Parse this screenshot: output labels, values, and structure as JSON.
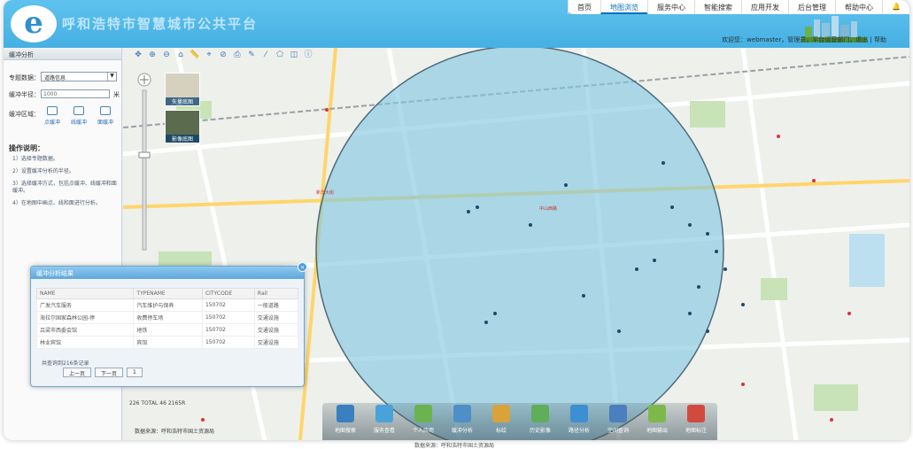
{
  "header": {
    "logo_letter": "e",
    "system_title": "呼和浩特市智慧城市公共平台",
    "nav": [
      "首页",
      "地图浏览",
      "服务中心",
      "智能搜索",
      "应用开发",
      "后台管理",
      "帮助中心"
    ],
    "nav_active_index": 1,
    "user_info": "欢迎您：webmaster，管理员，平台运营部门，退出 | 帮助"
  },
  "sidebar": {
    "panel_title": "缓冲分析",
    "topic_label": "专题数据：",
    "topic_value": "道路信息",
    "radius_label": "缓冲半径：",
    "radius_value": "1000",
    "radius_unit": "米",
    "area_label": "缓冲区域：",
    "tools": [
      "点缓冲",
      "线缓冲",
      "面缓冲"
    ],
    "instructions_title": "操作说明：",
    "instructions": [
      "1）选择专题数据。",
      "2）设置缓冲分析的半径。",
      "3）选择缓冲方式，包括点缓冲、线缓冲和面缓冲。",
      "4）在地图中画点、线和面进行分析。"
    ]
  },
  "map": {
    "thumbs": [
      "矢量底图",
      "影像底图"
    ],
    "scale_text": "226 TOTAL  46 2165R",
    "source_note": "数据来源：呼和浩特市国土资源局",
    "bottom_caption": "数据来源：呼和浩特市国土资源局",
    "labels": [
      "新华大街",
      "中山西路"
    ]
  },
  "result": {
    "title": "缓冲分析结果",
    "columns": [
      "NAME",
      "TYPENAME",
      "CITYCODE",
      "Rail"
    ],
    "rows": [
      [
        "广发汽车服务",
        "汽车维护与保养",
        "150702",
        "一般道路"
      ],
      [
        "海拉尔国家森林公园-停",
        "收费停车场",
        "150702",
        "交通设施"
      ],
      [
        "吕梁市西委会馆",
        "地铁",
        "150702",
        "交通设施"
      ],
      [
        "林业宾馆",
        "宾馆",
        "150702",
        "交通设施"
      ]
    ],
    "summary": "共查询到216条记录",
    "pager": [
      "上一页",
      "下一页",
      "1"
    ]
  },
  "dock": [
    "地图搜索",
    "服务查看",
    "个人应用",
    "缓冲分析",
    "标绘",
    "历史影像",
    "路径分析",
    "空间查询",
    "地图输出",
    "地图标注"
  ],
  "colors": {
    "header": "#4db4e6",
    "buffer_fill": "#7fc6e0",
    "accent": "#2f8fd1"
  }
}
